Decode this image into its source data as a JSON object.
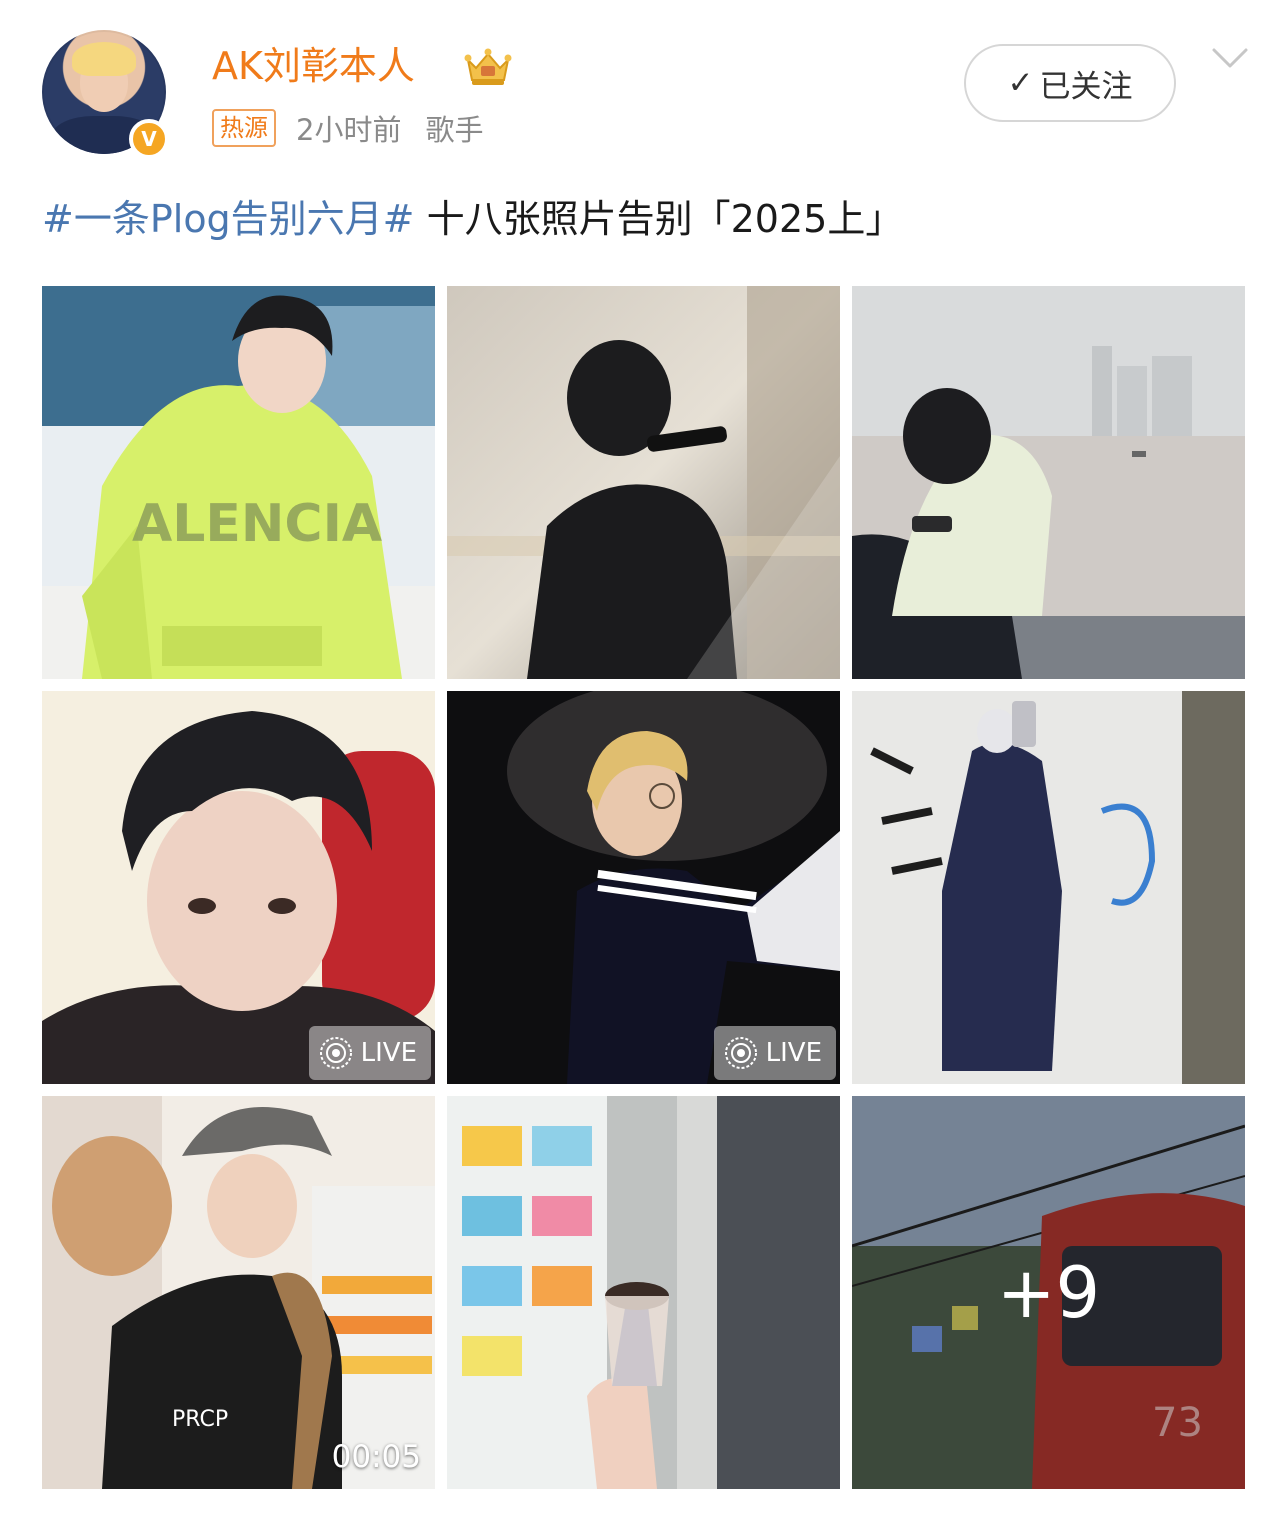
{
  "post": {
    "author": {
      "name": "AK刘彰本人",
      "verified_mark": "V",
      "avatar_icon": "avatar-photo"
    },
    "meta": {
      "tag": "热源",
      "time": "2小时前",
      "category": "歌手"
    },
    "follow_button": {
      "check": "✓",
      "label": "已关注"
    },
    "text": {
      "topic": "#一条Plog告别六月#",
      "body": " 十八张照片告别「2025上」"
    }
  },
  "photos": [
    {
      "description_icon": "photo-green-hoodie",
      "badge": null
    },
    {
      "description_icon": "photo-stage-silhouette",
      "badge": null
    },
    {
      "description_icon": "photo-seaside",
      "badge": null
    },
    {
      "description_icon": "photo-selfie",
      "badge": "LIVE"
    },
    {
      "description_icon": "photo-glasses-profile",
      "badge": "LIVE"
    },
    {
      "description_icon": "photo-mirror-selfie",
      "badge": null
    },
    {
      "description_icon": "photo-supermarket",
      "duration": "00:05"
    },
    {
      "description_icon": "photo-ice-cream",
      "badge": null
    },
    {
      "description_icon": "photo-cable-car",
      "more": "+9"
    }
  ],
  "colors": {
    "username": "#f07b1a",
    "topic": "#4a77b0",
    "meta": "#8a8a8a",
    "verified": "#f5a623"
  }
}
